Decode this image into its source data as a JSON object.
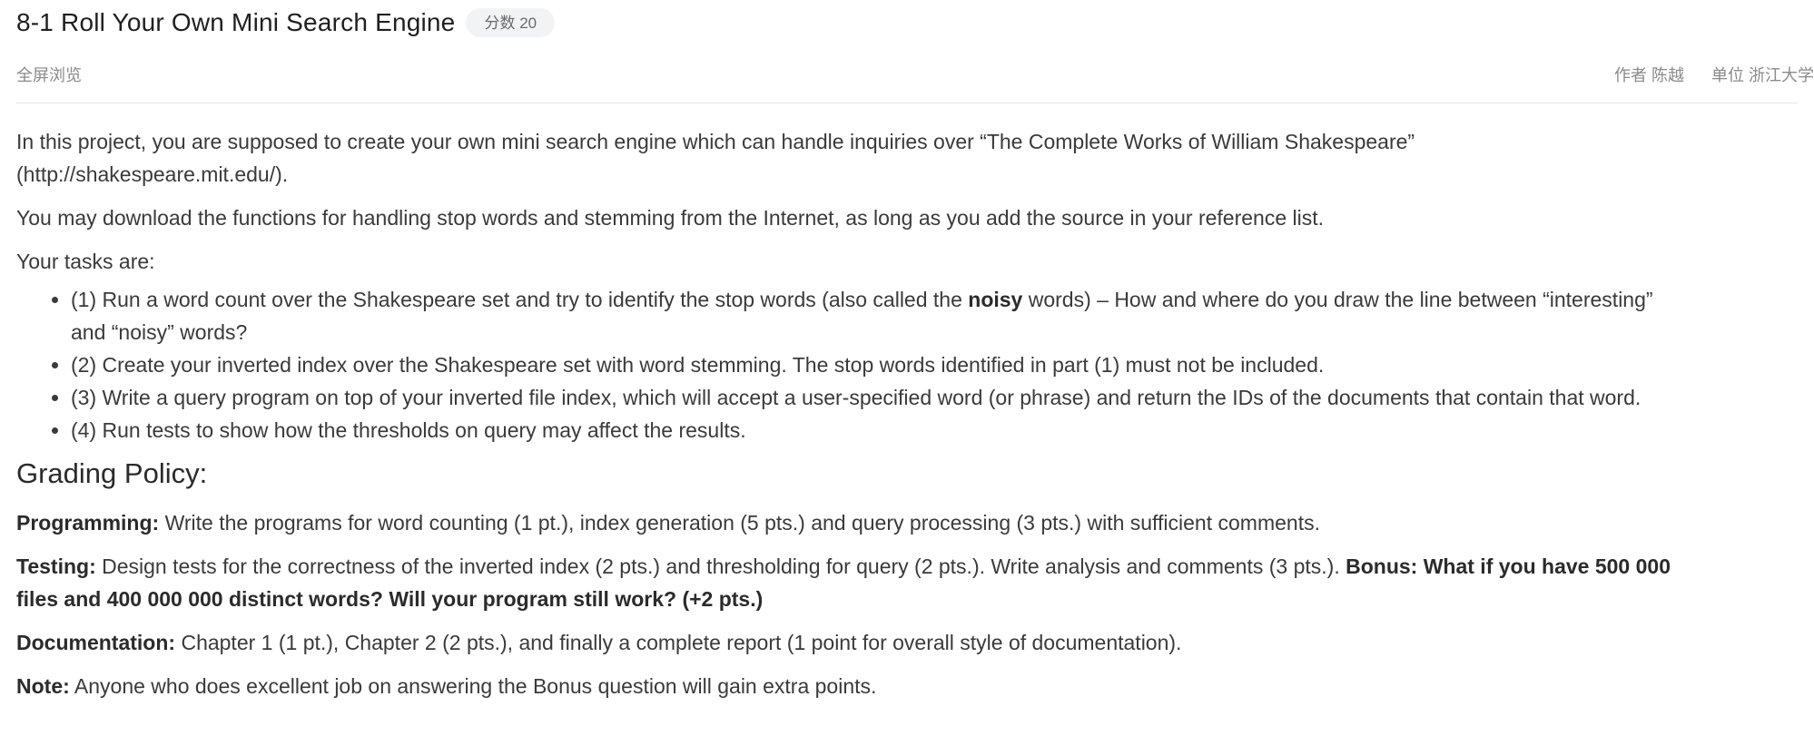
{
  "header": {
    "title": "8-1 Roll Your Own Mini Search Engine",
    "score_badge": "分数 20"
  },
  "subheader": {
    "fullscreen": "全屏浏览",
    "author": "作者 陈越",
    "unit": "单位 浙江大学"
  },
  "content": {
    "intro_p1_line1": "In this project, you are supposed to create your own mini search engine which can handle inquiries over “The Complete Works of William Shakespeare”",
    "intro_p1_line2": "(http://shakespeare.mit.edu/).",
    "intro_p2": "You may download the functions for handling stop words and stemming from the Internet, as long as you add the source in your reference list.",
    "tasks_label": "Your tasks are:",
    "tasks": [
      {
        "pre": "(1) Run a word count over the Shakespeare set and try to identify the stop words (also called the ",
        "bold": "noisy",
        "post": " words) – How and where do you draw the line between “interesting”",
        "line2": "and “noisy” words?"
      },
      {
        "text": "(2) Create your inverted index over the Shakespeare set with word stemming. The stop words identified in part (1) must not be included."
      },
      {
        "text": "(3) Write a query program on top of your inverted file index, which will accept a user-specified word (or phrase) and return the IDs of the documents that contain that word."
      },
      {
        "text": "(4) Run tests to show how the thresholds on query may affect the results."
      }
    ],
    "grading_title": "Grading Policy:",
    "programming": {
      "label": "Programming:",
      "text": " Write the programs for word counting (1 pt.), index generation (5 pts.) and query processing (3 pts.) with sufficient comments."
    },
    "testing": {
      "label": "Testing:",
      "text": " Design tests for the correctness of the inverted index (2 pts.) and thresholding for query (2 pts.).  Write analysis and comments (3 pts.).  ",
      "bonus_line1": "Bonus: What if you have 500 000",
      "bonus_line2": "files and 400 000 000 distinct words?  Will your program still work? (+2 pts.)"
    },
    "documentation": {
      "label": "Documentation:",
      "text": " Chapter 1 (1 pt.), Chapter 2 (2 pts.), and finally a complete report (1 point for overall style of documentation)."
    },
    "note": {
      "label": "Note:",
      "text": " Anyone who does excellent job on answering the Bonus question will gain extra points."
    }
  }
}
